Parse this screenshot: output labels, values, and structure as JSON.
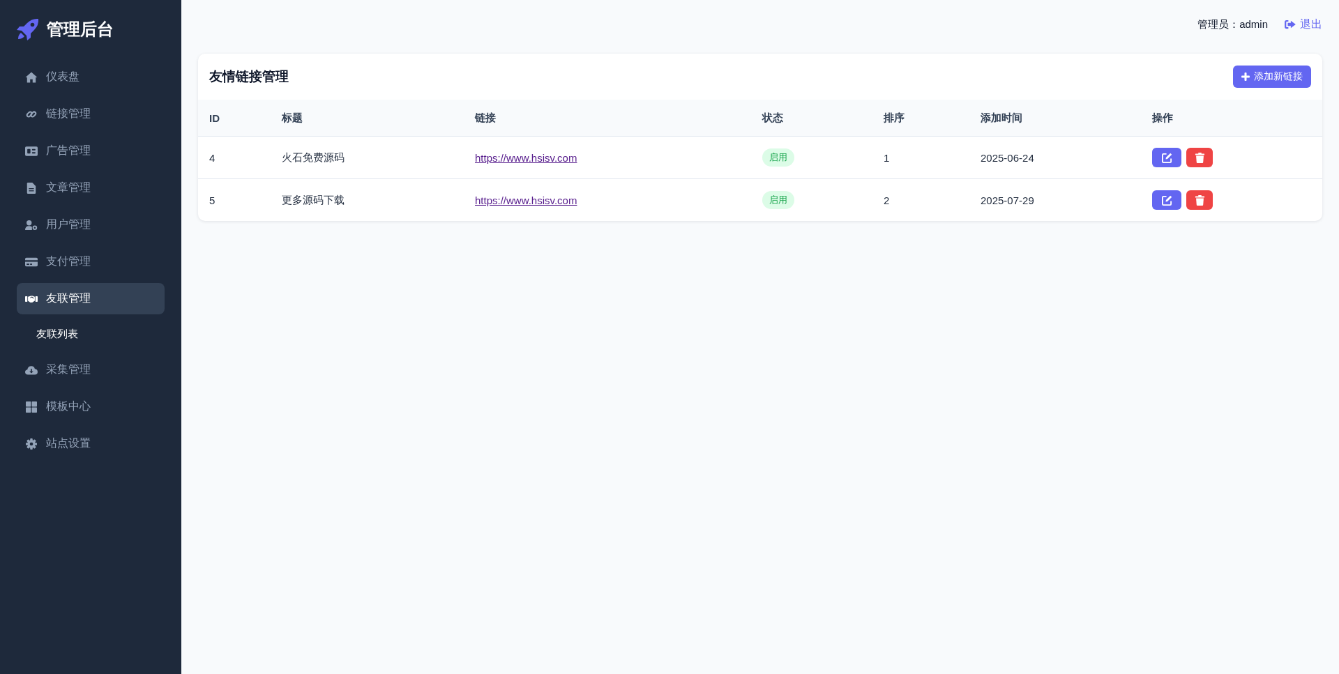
{
  "sidebar": {
    "brand": "管理后台",
    "items": [
      {
        "label": "仪表盘",
        "selected": false
      },
      {
        "label": "链接管理",
        "selected": false
      },
      {
        "label": "广告管理",
        "selected": false
      },
      {
        "label": "文章管理",
        "selected": false
      },
      {
        "label": "用户管理",
        "selected": false
      },
      {
        "label": "支付管理",
        "selected": false
      },
      {
        "label": "友联管理",
        "selected": true,
        "children": [
          {
            "label": "友联列表",
            "selected": true
          }
        ]
      },
      {
        "label": "采集管理",
        "selected": false
      },
      {
        "label": "模板中心",
        "selected": false
      },
      {
        "label": "站点设置",
        "selected": false
      }
    ]
  },
  "header": {
    "user": "管理员：admin",
    "logout": "退出"
  },
  "card": {
    "title": "友情链接管理",
    "add_button": "添加新链接",
    "table": {
      "columns": [
        "ID",
        "标题",
        "链接",
        "状态",
        "排序",
        "添加时间",
        "操作"
      ],
      "rows": [
        {
          "id": "4",
          "title": "火石免费源码",
          "url": "https://www.hsisv.com",
          "status": "启用",
          "enabled": true,
          "order": "1",
          "added": "2025-06-24"
        },
        {
          "id": "5",
          "title": "更多源码下载",
          "url": "https://www.hsisv.com",
          "status": "启用",
          "enabled": true,
          "order": "2",
          "added": "2025-07-29"
        }
      ]
    }
  }
}
